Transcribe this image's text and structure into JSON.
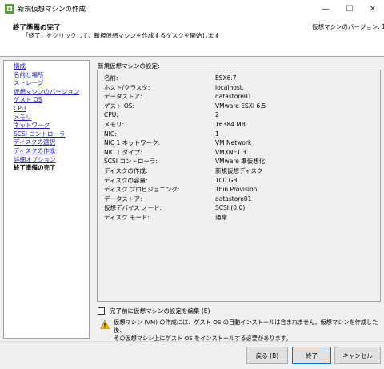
{
  "window": {
    "title": "新規仮想マシンの作成",
    "min_glyph": "—",
    "max_glyph": "☐",
    "close_glyph": "✕"
  },
  "header": {
    "title": "終了準備の完了",
    "subtitle": "「終了」をクリックして、新規仮想マシンを作成するタスクを開始します",
    "version": "仮想マシンのバージョン: 11"
  },
  "nav": {
    "items": [
      {
        "label": "構成"
      },
      {
        "label": "名前と場所"
      },
      {
        "label": "ストレージ"
      },
      {
        "label": "仮想マシンのバージョン"
      },
      {
        "label": "ゲスト OS"
      },
      {
        "label": "CPU"
      },
      {
        "label": "メモリ"
      },
      {
        "label": "ネットワーク"
      },
      {
        "label": "SCSI コントローラ"
      },
      {
        "label": "ディスクの選択"
      },
      {
        "label": "ディスクの作成"
      },
      {
        "label": "詳細オプション"
      },
      {
        "label": "終了準備の完了"
      }
    ]
  },
  "settings": {
    "label": "新規仮想マシンの設定:",
    "rows": [
      {
        "key": "名前:",
        "value": "ESX6.7"
      },
      {
        "key": "ホスト/クラスタ:",
        "value": "localhost."
      },
      {
        "key": "データストア:",
        "value": "datastore01"
      },
      {
        "key": "ゲスト OS:",
        "value": "VMware ESXi 6.5"
      },
      {
        "key": "CPU:",
        "value": "2"
      },
      {
        "key": "メモリ:",
        "value": "16384 MB"
      },
      {
        "key": "NIC:",
        "value": "1"
      },
      {
        "key": "NIC 1 ネットワーク:",
        "value": "VM Network"
      },
      {
        "key": "NIC 1 タイプ:",
        "value": "VMXNET 3"
      },
      {
        "key": "SCSI コントローラ:",
        "value": "VMware 準仮想化"
      },
      {
        "key": "ディスクの作成:",
        "value": "新規仮想ディスク"
      },
      {
        "key": "ディスクの容量:",
        "value": "100 GB"
      },
      {
        "key": "ディスク プロビジョニング:",
        "value": "Thin Provision"
      },
      {
        "key": "データストア:",
        "value": "datastore01"
      },
      {
        "key": "仮想デバイス ノード:",
        "value": "SCSI (0:0)"
      },
      {
        "key": "ディスク モード:",
        "value": "通常"
      }
    ]
  },
  "edit_checkbox": {
    "label": "完了前に仮想マシンの設定を編集 (E)",
    "checked": false
  },
  "warning": {
    "line1": "仮想マシン (VM) の作成には、ゲスト OS の自動インストールは含まれません。仮想マシンを作成した後、",
    "line2": "その仮想マシン上にゲスト OS をインストールする必要があります。"
  },
  "buttons": {
    "back": "戻る (B)",
    "finish": "終了",
    "cancel": "キャンセル"
  }
}
